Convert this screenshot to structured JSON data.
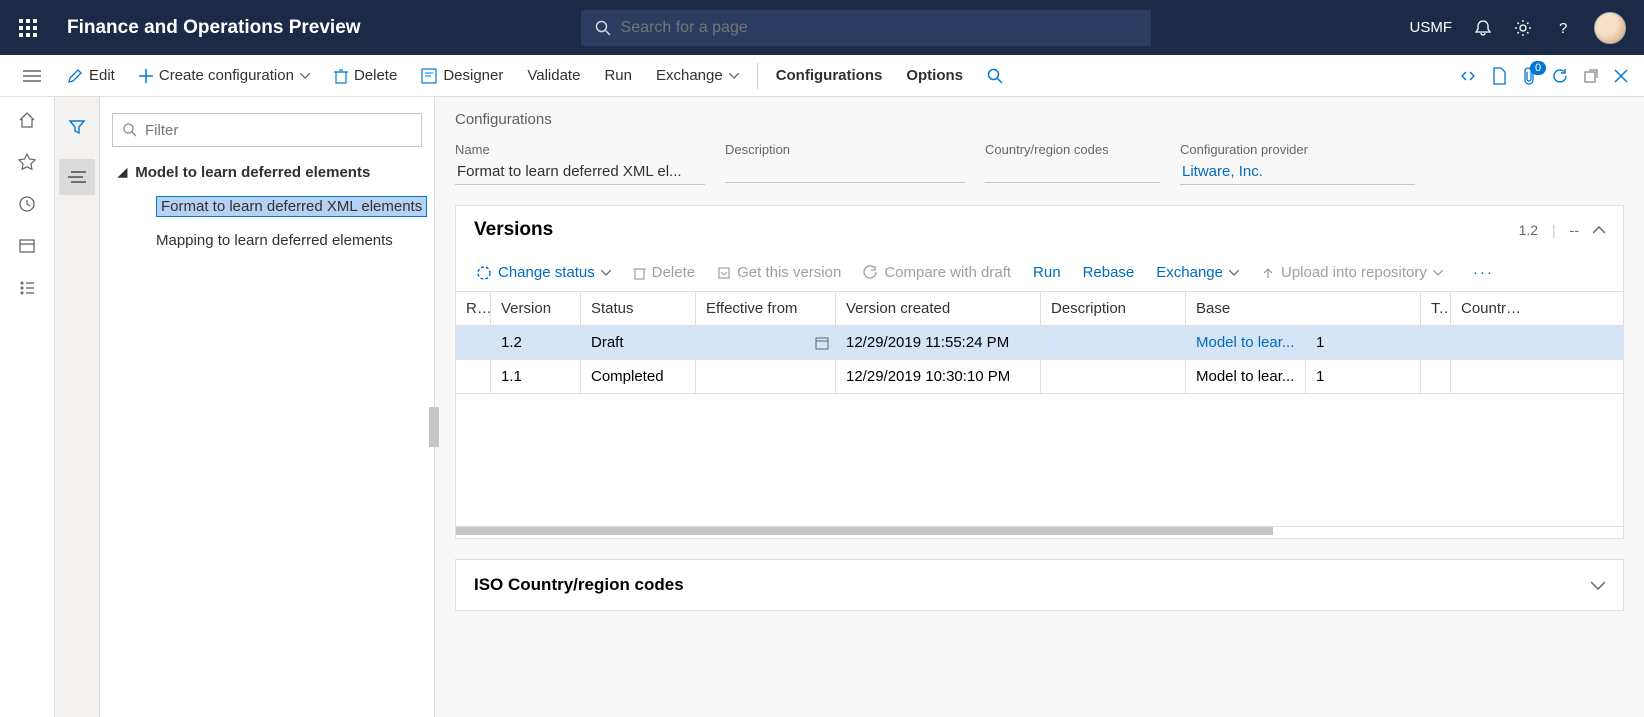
{
  "topbar": {
    "app_title": "Finance and Operations Preview",
    "search_placeholder": "Search for a page",
    "company": "USMF"
  },
  "actionbar": {
    "edit": "Edit",
    "create": "Create configuration",
    "delete": "Delete",
    "designer": "Designer",
    "validate": "Validate",
    "run": "Run",
    "exchange": "Exchange",
    "configurations": "Configurations",
    "options": "Options",
    "attach_badge": "0"
  },
  "tree": {
    "filter_placeholder": "Filter",
    "parent": "Model to learn deferred elements",
    "children": [
      "Format to learn deferred XML elements",
      "Mapping to learn deferred elements"
    ]
  },
  "details": {
    "section_title": "Configurations",
    "fields": {
      "name_label": "Name",
      "name_value": "Format to learn deferred XML el...",
      "desc_label": "Description",
      "desc_value": "",
      "ctry_label": "Country/region codes",
      "ctry_value": "",
      "prov_label": "Configuration provider",
      "prov_value": "Litware, Inc."
    }
  },
  "versions": {
    "title": "Versions",
    "summary_version": "1.2",
    "summary_dashes": "--",
    "toolbar": {
      "change_status": "Change status",
      "delete": "Delete",
      "get_version": "Get this version",
      "compare": "Compare with draft",
      "run": "Run",
      "rebase": "Rebase",
      "exchange": "Exchange",
      "upload": "Upload into repository"
    },
    "columns": {
      "r": "R...",
      "version": "Version",
      "status": "Status",
      "effective": "Effective from",
      "created": "Version created",
      "description": "Description",
      "base": "Base",
      "t": "T...",
      "ctry": "Country/reg"
    },
    "rows": [
      {
        "version": "1.2",
        "status": "Draft",
        "effective": "",
        "created": "12/29/2019 11:55:24 PM",
        "description": "",
        "base": "Model to lear...",
        "base_num": "1",
        "selected": true,
        "base_link": true
      },
      {
        "version": "1.1",
        "status": "Completed",
        "effective": "",
        "created": "12/29/2019 10:30:10 PM",
        "description": "",
        "base": "Model to lear...",
        "base_num": "1",
        "selected": false,
        "base_link": false
      }
    ]
  },
  "iso": {
    "title": "ISO Country/region codes"
  }
}
